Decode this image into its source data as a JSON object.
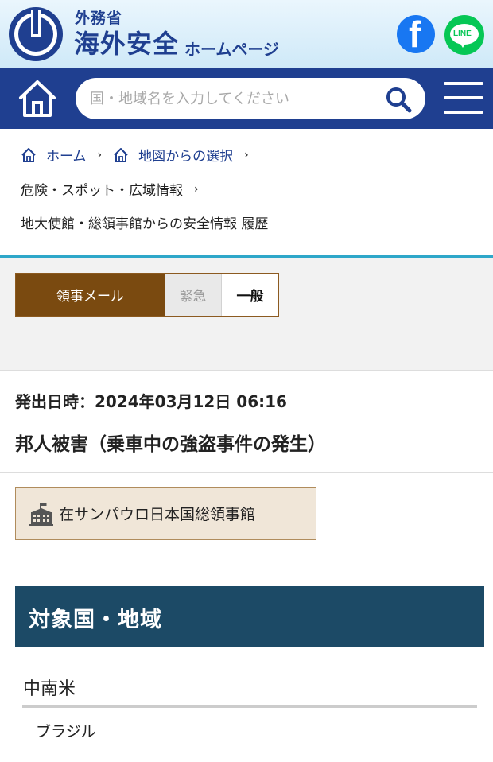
{
  "header": {
    "ministry": "外務省",
    "site_title": "海外安全",
    "site_subtitle": "ホームページ",
    "brand_color": "#1f3f90",
    "facebook_icon": "facebook-icon",
    "line_icon": "line-icon",
    "line_text": "LINE"
  },
  "nav": {
    "search_placeholder": "国・地域名を入力してください",
    "home_icon": "home-icon",
    "search_icon": "search-icon",
    "menu_icon": "hamburger-menu-icon"
  },
  "breadcrumb": {
    "home": "ホーム",
    "map": "地図からの選択",
    "danger": "危険・スポット・広域情報",
    "current": "地大使館・総領事館からの安全情報 履歴",
    "separator": "›"
  },
  "tabs": {
    "mail": "領事メール",
    "urgent": "緊急",
    "general": "一般",
    "active_color": "#7a4a10"
  },
  "article": {
    "date": "発出日時：2024年03月12日 06:16",
    "title": "邦人被害（乗車中の強盗事件の発生）",
    "source": "在サンパウロ日本国総領事館"
  },
  "target": {
    "header": "対象国・地域",
    "region": "中南米",
    "country": "ブラジル",
    "header_color": "#1c4a66"
  }
}
